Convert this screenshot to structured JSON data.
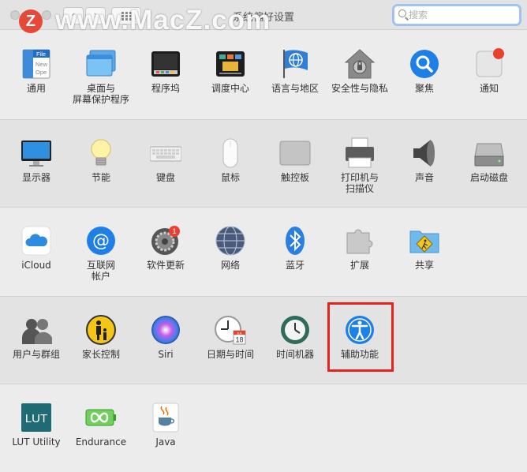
{
  "window": {
    "title": "系统偏好设置",
    "search_placeholder": "搜索",
    "back_glyph": "‹",
    "forward_glyph": "›"
  },
  "watermark": {
    "badge": "Z",
    "text": "www.MacZ.com"
  },
  "rows": [
    {
      "items": [
        {
          "label": "通用",
          "icon": "general-icon"
        },
        {
          "label": "桌面与\n屏幕保护程序",
          "icon": "desktop-icon"
        },
        {
          "label": "程序坞",
          "icon": "dock-icon"
        },
        {
          "label": "调度中心",
          "icon": "mission-control-icon"
        },
        {
          "label": "语言与地区",
          "icon": "flag-globe-icon"
        },
        {
          "label": "安全性与隐私",
          "icon": "house-lock-icon"
        },
        {
          "label": "聚焦",
          "icon": "magnifier-icon"
        },
        {
          "label": "通知",
          "icon": "notification-icon"
        }
      ]
    },
    {
      "items": [
        {
          "label": "显示器",
          "icon": "display-icon"
        },
        {
          "label": "节能",
          "icon": "light-bulb-icon"
        },
        {
          "label": "键盘",
          "icon": "keyboard-icon"
        },
        {
          "label": "鼠标",
          "icon": "mouse-icon"
        },
        {
          "label": "触控板",
          "icon": "trackpad-icon"
        },
        {
          "label": "打印机与\n扫描仪",
          "icon": "printer-icon"
        },
        {
          "label": "声音",
          "icon": "speaker-icon"
        },
        {
          "label": "启动磁盘",
          "icon": "hard-disk-icon"
        }
      ]
    },
    {
      "items": [
        {
          "label": "iCloud",
          "icon": "cloud-icon"
        },
        {
          "label": "互联网\n帐户",
          "icon": "at-sign-icon"
        },
        {
          "label": "软件更新",
          "icon": "software-update-gear-icon",
          "badge": "1"
        },
        {
          "label": "网络",
          "icon": "network-globe-icon"
        },
        {
          "label": "蓝牙",
          "icon": "bluetooth-icon"
        },
        {
          "label": "扩展",
          "icon": "puzzle-icon"
        },
        {
          "label": "共享",
          "icon": "sharing-folder-icon"
        }
      ]
    },
    {
      "items": [
        {
          "label": "用户与群组",
          "icon": "users-icon"
        },
        {
          "label": "家长控制",
          "icon": "parental-controls-icon"
        },
        {
          "label": "Siri",
          "icon": "siri-icon"
        },
        {
          "label": "日期与时间",
          "icon": "clock-calendar-icon",
          "calendar_month": "JUL",
          "calendar_day": "18"
        },
        {
          "label": "时间机器",
          "icon": "time-machine-icon"
        },
        {
          "label": "辅助功能",
          "icon": "accessibility-icon"
        }
      ]
    },
    {
      "items": [
        {
          "label": "LUT Utility",
          "icon": "lut-icon",
          "icon_text": "LUT"
        },
        {
          "label": "Endurance",
          "icon": "battery-infinity-icon"
        },
        {
          "label": "Java",
          "icon": "java-cup-icon"
        }
      ]
    }
  ],
  "general_icon_lines": [
    "File",
    "New",
    "Ope"
  ],
  "colors": {
    "highlight": "#e8231f",
    "accent_blue": "#1e7fe6",
    "badge_red": "#e8412d"
  }
}
